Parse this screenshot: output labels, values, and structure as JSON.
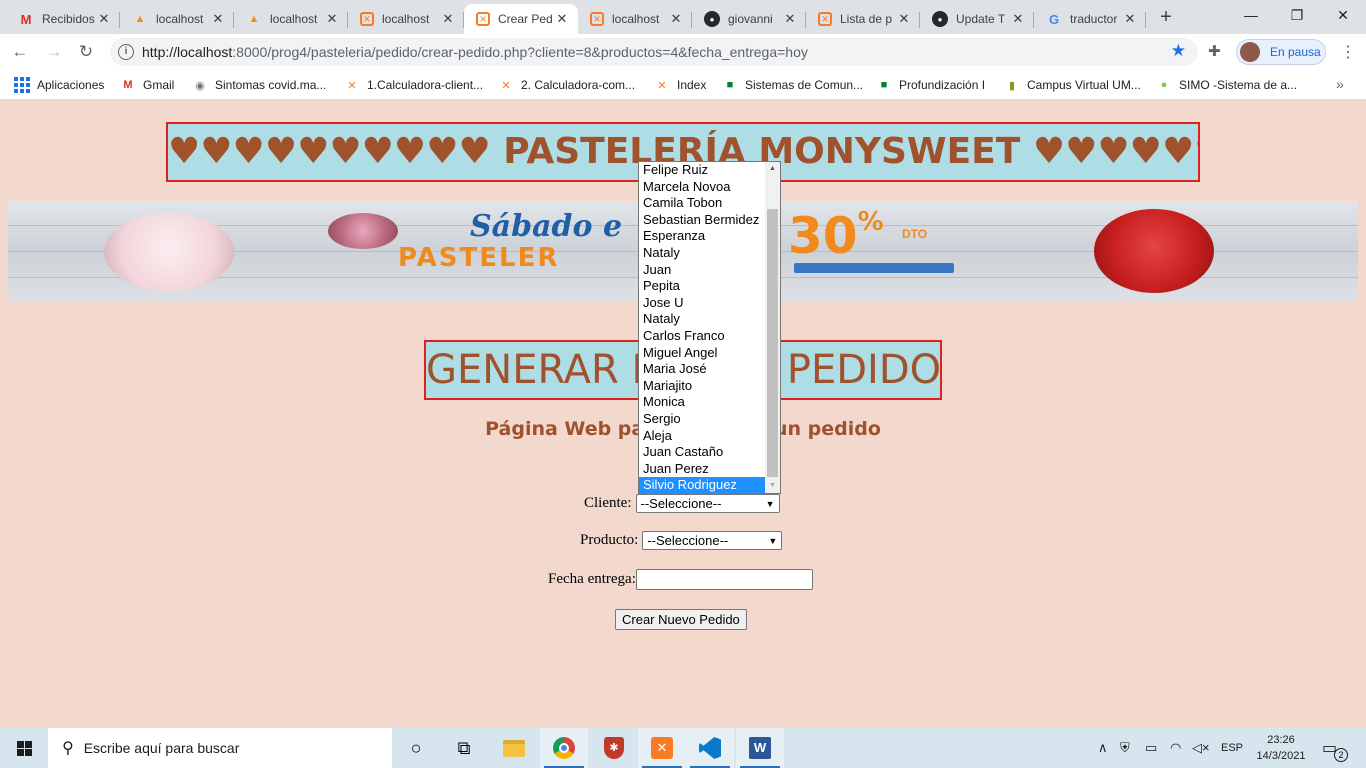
{
  "browser": {
    "tabs": [
      {
        "title": "Recibidos",
        "icon": "gmail-icon",
        "glyph": "M"
      },
      {
        "title": "localhost",
        "icon": "phpmyadmin-icon",
        "glyph": "▲"
      },
      {
        "title": "localhost",
        "icon": "phpmyadmin-icon",
        "glyph": "▲"
      },
      {
        "title": "localhost",
        "icon": "xampp-icon",
        "glyph": "✕"
      },
      {
        "title": "Crear Ped",
        "icon": "xampp-icon",
        "glyph": "✕"
      },
      {
        "title": "localhost",
        "icon": "xampp-icon",
        "glyph": "✕"
      },
      {
        "title": "giovanni",
        "icon": "github-icon",
        "glyph": "●"
      },
      {
        "title": "Lista de p",
        "icon": "xampp-icon",
        "glyph": "✕"
      },
      {
        "title": "Update T",
        "icon": "github-icon",
        "glyph": "●"
      },
      {
        "title": "traductor",
        "icon": "google-icon",
        "glyph": "G"
      }
    ],
    "new_tab": "+",
    "url_host": "http://localhost",
    "url_path": ":8000/prog4/pasteleria/pedido/crear-pedido.php?cliente=8&productos=4&fecha_entrega=hoy",
    "profile_status": "En pausa",
    "bookmarks": [
      {
        "label": "Aplicaciones",
        "icon": "apps-icon"
      },
      {
        "label": "Gmail",
        "icon": "gmail-icon"
      },
      {
        "label": "Sintomas covid.ma...",
        "icon": "site-icon"
      },
      {
        "label": "1.Calculadora-client...",
        "icon": "xampp-icon"
      },
      {
        "label": "2. Calculadora-com...",
        "icon": "xampp-icon"
      },
      {
        "label": "Index",
        "icon": "xampp-icon"
      },
      {
        "label": "Sistemas de Comun...",
        "icon": "meet-icon"
      },
      {
        "label": "Profundización I",
        "icon": "meet-icon"
      },
      {
        "label": "Campus Virtual UM...",
        "icon": "campus-icon"
      },
      {
        "label": "SIMO -Sistema de a...",
        "icon": "leaf-icon"
      }
    ]
  },
  "page": {
    "title": "♥♥♥♥♥♥♥♥♥♥ PASTELERÍA MONYSWEET ♥♥♥♥♥♥♥♥♥",
    "banner": {
      "line1": "Sábado e",
      "line2": "PASTELER",
      "percent": "30",
      "percent_sign": "%",
      "dto": "DTO"
    },
    "section_title": "GENERAR NUEVO PEDIDO",
    "subtitle": "Página Web para registrar un pedido",
    "form": {
      "cliente_label": "Cliente:",
      "cliente_value": "--Seleccione--",
      "producto_label": "Producto:",
      "producto_value": "--Seleccione--",
      "fecha_label": "Fecha entrega:",
      "fecha_value": "",
      "submit_label": "Crear Nuevo Pedido"
    },
    "dropdown_options": [
      "Felipe Ruiz",
      "Marcela Novoa",
      "Camila Tobon",
      "Sebastian Bermidez",
      "Esperanza",
      "Nataly",
      "Juan",
      "Pepita",
      "Jose U",
      "Nataly",
      "Carlos Franco",
      "Miguel Angel",
      "Maria José",
      "Mariajito",
      "Monica",
      "Sergio",
      "Aleja",
      "Juan Castaño",
      "Juan Perez",
      "Silvio Rodriguez"
    ],
    "dropdown_selected": "Silvio Rodriguez"
  },
  "taskbar": {
    "search_placeholder": "Escribe aquí para buscar",
    "language": "ESP",
    "time": "23:26",
    "date": "14/3/2021",
    "notification_count": "2"
  }
}
